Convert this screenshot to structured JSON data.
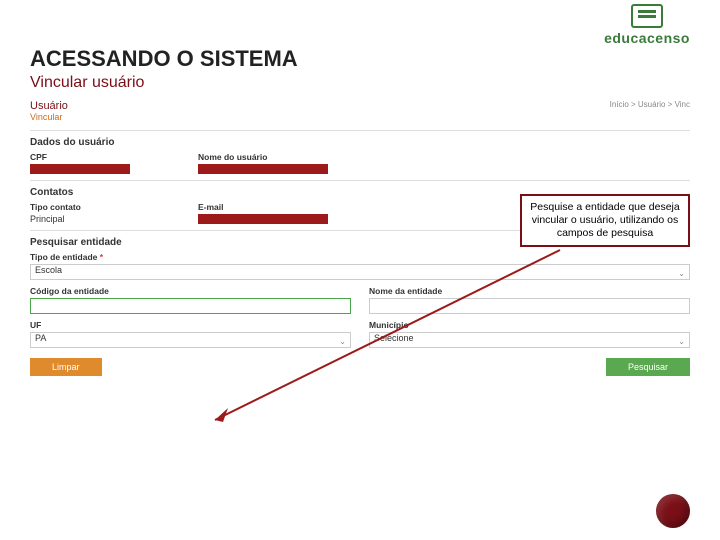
{
  "brand": {
    "name": "educacenso"
  },
  "page": {
    "title": "ACESSANDO O SISTEMA",
    "subtitle": "Vincular usuário"
  },
  "breadcrumb": "Início > Usuário > Vinc",
  "panel": {
    "title": "Usuário",
    "subtitle": "Vincular"
  },
  "callout": "Pesquise a entidade que deseja vincular o usuário, utilizando os campos de pesquisa",
  "form": {
    "dados": {
      "heading": "Dados do usuário",
      "cpf_label": "CPF",
      "nome_label": "Nome do usuário"
    },
    "contatos": {
      "heading": "Contatos",
      "tipo_label": "Tipo contato",
      "tipo_value": "Principal",
      "email_label": "E-mail"
    },
    "pesquisar": {
      "heading": "Pesquisar entidade",
      "tipo_label": "Tipo de entidade",
      "tipo_value": "Escola",
      "codigo_label": "Código da entidade",
      "nome_label": "Nome da entidade",
      "uf_label": "UF",
      "uf_value": "PA",
      "mun_label": "Município",
      "mun_value": "Selecione"
    },
    "buttons": {
      "limpar": "Limpar",
      "pesquisar": "Pesquisar"
    }
  }
}
